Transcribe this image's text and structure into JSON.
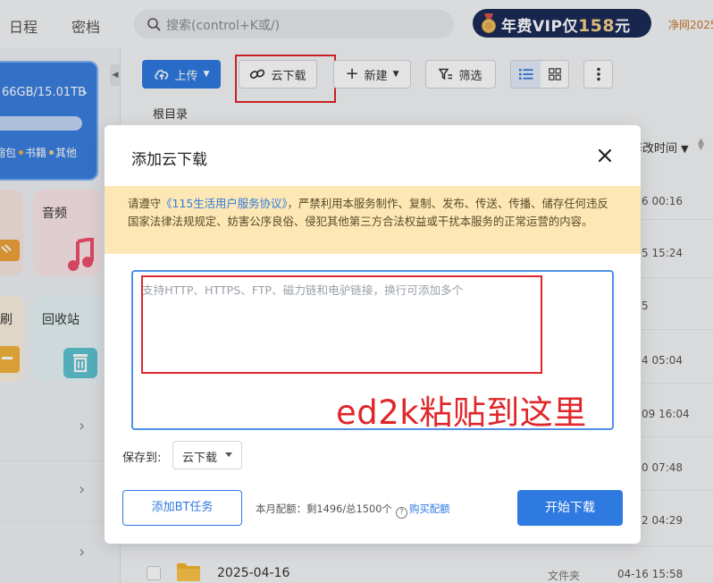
{
  "topbar": {
    "nav": [
      "日程",
      "密档"
    ],
    "search_placeholder": "搜索(control+K或/)",
    "vip": {
      "prefix": "年费VIP仅",
      "price": "158",
      "suffix": "元"
    },
    "netlink": "净网2025"
  },
  "sidebar": {
    "storage": {
      "usage": "66GB/15.01TB",
      "legend": [
        "缩包",
        "书籍",
        "其他"
      ],
      "legend_colors": [
        "#ffffff",
        "#f5b042",
        "#f7d37a"
      ]
    },
    "tiles": {
      "audio": "音频",
      "recycle": "回收站"
    }
  },
  "toolbar": {
    "upload": "上传",
    "cloud_download": "云下载",
    "new": "新建",
    "filter": "筛选"
  },
  "breadcrumb": "根目录",
  "filelist": {
    "sort_label": "修改时间",
    "times": [
      "6 00:16",
      "5 15:24",
      "5",
      "4 05:04",
      "09 16:04",
      "0 07:48",
      "2 04:29"
    ],
    "last_row": {
      "name": "2025-04-16",
      "type": "文件夹",
      "date": "04-16 15:58"
    }
  },
  "modal": {
    "title": "添加云下载",
    "notice": {
      "before": "请遵守",
      "link": "《115生活用户服务协议》",
      "after": "，严禁利用本服务制作、复制、发布、传送、传播、储存任何违反国家法律法规规定、妨害公序良俗、侵犯其他第三方合法权益或干扰本服务的正常运营的内容。"
    },
    "textarea_placeholder": "支持HTTP、HTTPS、FTP、磁力链和电驴链接，换行可添加多个",
    "annotation": "ed2k粘贴到这里",
    "save_to_label": "保存到:",
    "save_to_value": "云下载",
    "bt_button": "添加BT任务",
    "quota": {
      "text": "本月配额：剩1496/总1500个",
      "help": "?",
      "buy": "购买配额"
    },
    "start_button": "开始下载"
  },
  "colors": {
    "primary": "#2f7ae0",
    "annotation_red": "#e0262b",
    "notice_bg": "#fde7b4"
  }
}
